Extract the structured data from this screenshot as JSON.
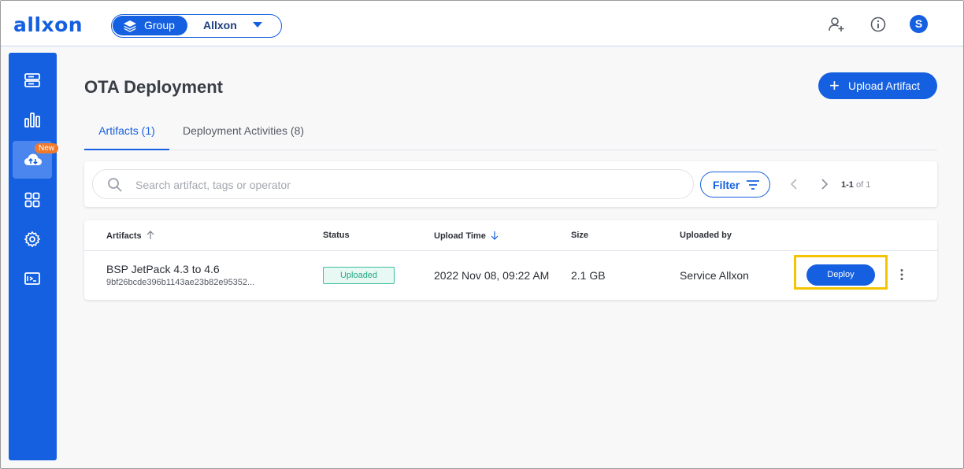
{
  "brand": {
    "logo": "allxon",
    "accent": "#1560e0"
  },
  "header": {
    "group_label": "Group",
    "group_name": "Allxon",
    "avatar_initial": "S",
    "icons": [
      "layers-icon",
      "chevron-down-icon",
      "add-user-icon",
      "info-icon",
      "avatar"
    ]
  },
  "sidebar": {
    "items": [
      {
        "icon": "server-icon",
        "active": false
      },
      {
        "icon": "bar-chart-icon",
        "active": false
      },
      {
        "icon": "cloud-upload-icon",
        "active": true,
        "badge": "New"
      },
      {
        "icon": "apps-grid-icon",
        "active": false
      },
      {
        "icon": "gear-icon",
        "active": false
      },
      {
        "icon": "terminal-icon",
        "active": false
      }
    ]
  },
  "main": {
    "title": "OTA Deployment",
    "upload_button": "Upload Artifact",
    "tabs": [
      {
        "label": "Artifacts (1)",
        "active": true
      },
      {
        "label": "Deployment Activities (8)",
        "active": false
      }
    ],
    "search": {
      "placeholder": "Search artifact, tags or operator"
    },
    "filter_label": "Filter",
    "pagination": {
      "range": "1-1",
      "of_text": "of 1"
    },
    "table": {
      "columns": [
        "Artifacts",
        "Status",
        "Upload Time",
        "Size",
        "Uploaded by"
      ],
      "rows": [
        {
          "name": "BSP JetPack 4.3 to 4.6",
          "hash": "9bf26bcde396b1143ae23b82e95352...",
          "status": "Uploaded",
          "upload_time": "2022 Nov 08, 09:22 AM",
          "size": "2.1 GB",
          "uploaded_by": "Service Allxon",
          "action": "Deploy"
        }
      ]
    }
  }
}
